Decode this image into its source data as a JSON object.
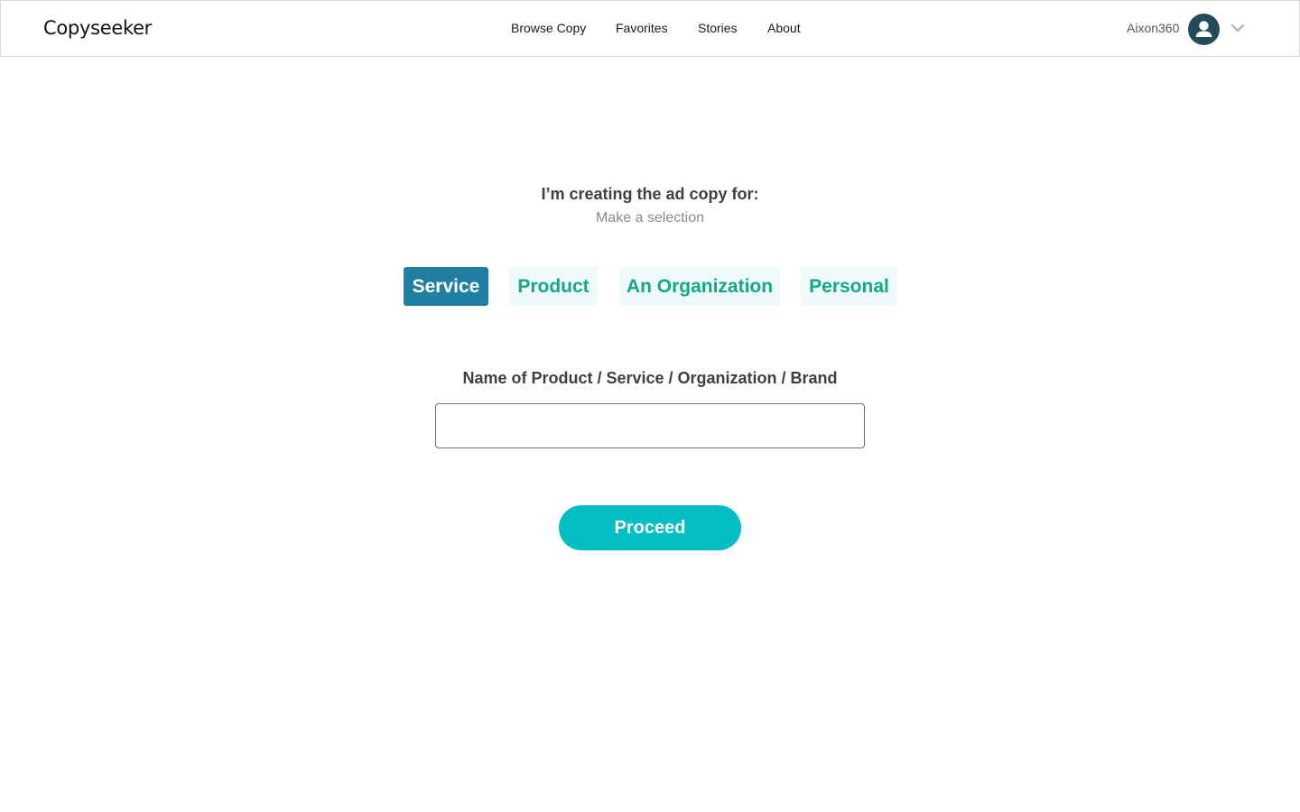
{
  "header": {
    "logo_text": "Copyseeker",
    "nav": [
      {
        "label": "Browse Copy"
      },
      {
        "label": "Favorites"
      },
      {
        "label": "Stories"
      },
      {
        "label": "About"
      }
    ],
    "user": {
      "name": "Aixon360",
      "avatar_icon": "user-icon",
      "menu_icon": "chevron-down-icon"
    }
  },
  "main": {
    "heading": "I’m creating the ad copy for:",
    "subheading": "Make a selection",
    "choices": [
      {
        "label": "Service",
        "selected": true
      },
      {
        "label": "Product",
        "selected": false
      },
      {
        "label": "An Organization",
        "selected": false
      },
      {
        "label": "Personal",
        "selected": false
      }
    ],
    "name_field": {
      "label": "Name of Product / Service / Organization / Brand",
      "value": "",
      "placeholder": ""
    },
    "proceed_label": "Proceed"
  },
  "colors": {
    "selected_bg": "#1f7fa3",
    "choice_bg": "#eefafa",
    "choice_text": "#14a888",
    "button_bg": "#03bec4",
    "avatar_bg": "#234b5c"
  }
}
